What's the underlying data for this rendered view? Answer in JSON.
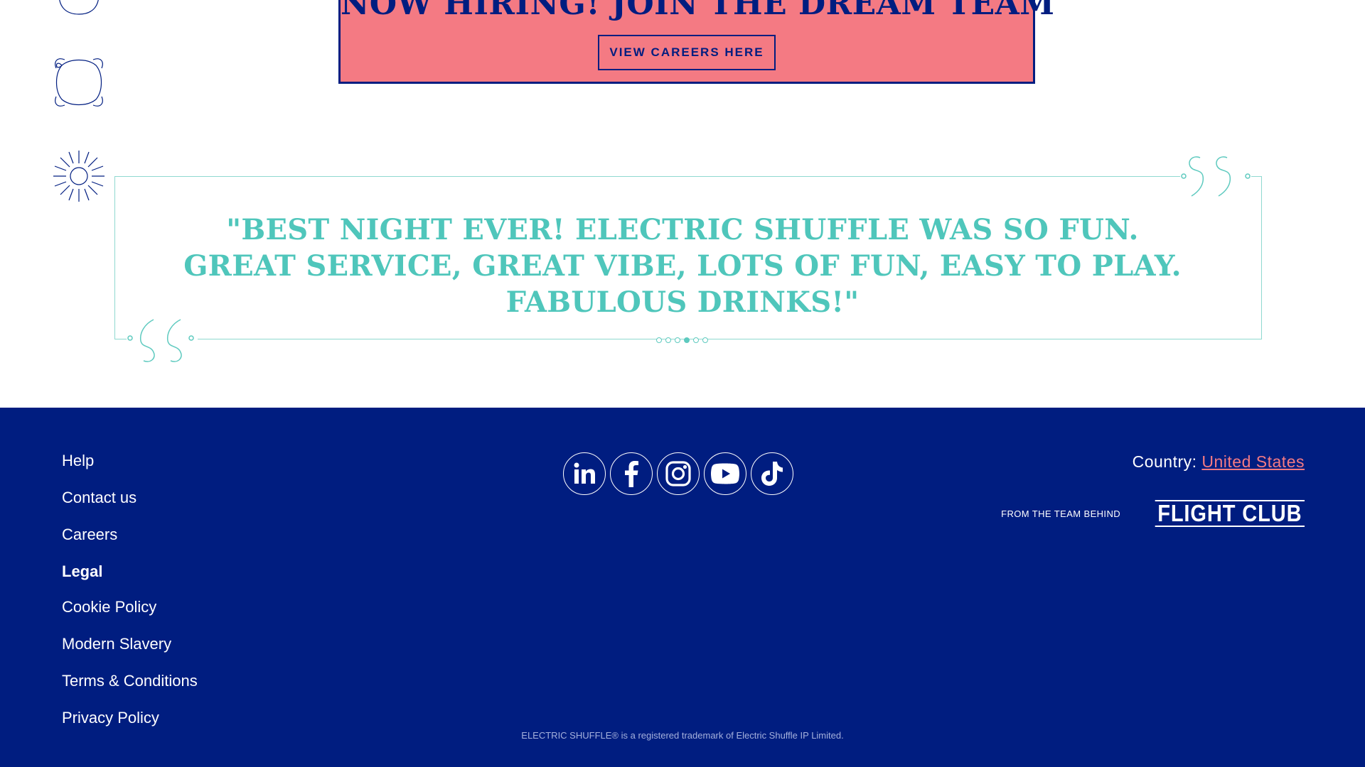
{
  "hiring": {
    "title": "NOW HIRING! JOIN THE DREAM TEAM",
    "button_label": "VIEW CAREERS HERE"
  },
  "testimonial": {
    "quote": "\"BEST NIGHT EVER! ELECTRIC SHUFFLE WAS SO FUN. GREAT SERVICE, GREAT VIBE, LOTS OF FUN, EASY TO PLAY. FABULOUS DRINKS!\"",
    "slides_total": 6,
    "active_slide": 4
  },
  "footer": {
    "nav": {
      "help": "Help",
      "contact": "Contact us",
      "careers": "Careers",
      "legal": "Legal",
      "cookie": "Cookie Policy",
      "slavery": "Modern Slavery",
      "terms": "Terms & Conditions",
      "privacy": "Privacy Policy"
    },
    "socials": [
      "linkedin-icon",
      "facebook-icon",
      "instagram-icon",
      "youtube-icon",
      "tiktok-icon"
    ],
    "country_label": "Country:",
    "country_value": "United States",
    "from_team": "FROM THE TEAM BEHIND",
    "flight_club": "FLIGHT CLUB",
    "trademark": "ELECTRIC SHUFFLE® is a registered trademark of Electric Shuffle IP Limited."
  },
  "colors": {
    "navy": "#001d80",
    "coral": "#f47a83",
    "teal": "#4fc6bb"
  }
}
